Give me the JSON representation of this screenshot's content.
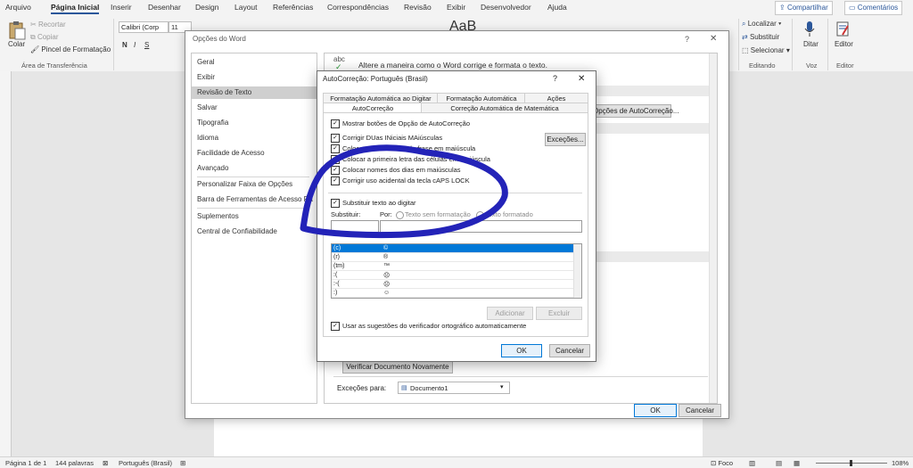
{
  "ribbon_tabs": [
    "Arquivo",
    "Página Inicial",
    "Inserir",
    "Desenhar",
    "Design",
    "Layout",
    "Referências",
    "Correspondências",
    "Revisão",
    "Exibir",
    "Desenvolvedor",
    "Ajuda"
  ],
  "top_buttons": {
    "share": "Compartilhar",
    "comments": "Comentários"
  },
  "clipboard": {
    "paste": "Colar",
    "cut": "Recortar",
    "copy": "Copiar",
    "format_painter": "Pincel de Formatação",
    "group": "Área de Transferência"
  },
  "font": {
    "name": "Calibri (Corp",
    "size": "11",
    "bold": "N",
    "italic": "I",
    "underline": "S"
  },
  "editing": {
    "find": "Localizar",
    "replace": "Substituir",
    "select": "Selecionar",
    "group": "Editando"
  },
  "voice": {
    "dictate": "Ditar",
    "group": "Voz"
  },
  "editor": {
    "label": "Editor",
    "group": "Editor"
  },
  "styles_preview": "AaB",
  "word_options": {
    "title": "Opções do Word",
    "nav": [
      "Geral",
      "Exibir",
      "Revisão de Texto",
      "Salvar",
      "Tipografia",
      "Idioma",
      "Facilidade de Acesso",
      "Avançado",
      "Personalizar Faixa de Opções",
      "Barra de Ferramentas de Acesso Rápido",
      "Suplementos",
      "Central de Confiabilidade"
    ],
    "header_icon": "abc",
    "header_text": "Altere a maneira como o Word corrige e formata o texto.",
    "autocorrect_options_button": "Opções de AutoCorreção...",
    "recheck_button": "Verificar Documento Novamente",
    "exceptions_label": "Exceções para:",
    "exceptions_value": "Documento1",
    "ok": "OK",
    "cancel": "Cancelar"
  },
  "autocorrect": {
    "title": "AutoCorreção: Português (Brasil)",
    "tabs_row1": [
      "Formatação Automática ao Digitar",
      "Formatação Automática",
      "Ações"
    ],
    "tabs_row2": [
      "AutoCorreção",
      "Correção Automática de Matemática"
    ],
    "show_buttons": "Mostrar botões de Opção de AutoCorreção",
    "two_initial": "Corrigir DUas INiciais MAiúsculas",
    "first_letter_sentence": "Colocar primeira letra da frase em maiúscula",
    "first_letter_cells": "Colocar a primeira letra das células em maiúscula",
    "day_names": "Colocar nomes dos dias em maiúsculas",
    "caps_lock": "Corrigir uso acidental da tecla cAPS LOCK",
    "exceptions_button": "Exceções...",
    "replace_as_type": "Substituir texto ao digitar",
    "replace_label": "Substituir:",
    "with_label": "Por:",
    "plain_text": "Texto sem formatação",
    "formatted_text": "Texto formatado",
    "list": [
      {
        "from": "(c)",
        "to": "©"
      },
      {
        "from": "(r)",
        "to": "®"
      },
      {
        "from": "(tm)",
        "to": "™"
      },
      {
        "from": ":(",
        "to": "☹"
      },
      {
        "from": ":-(",
        "to": "☹"
      },
      {
        "from": ":)",
        "to": "☺"
      }
    ],
    "add_button": "Adicionar",
    "delete_button": "Excluir",
    "spellcheck": "Usar as sugestões do verificador ortográfico automaticamente",
    "ok": "OK",
    "cancel": "Cancelar"
  },
  "status": {
    "page": "Página 1 de 1",
    "words": "144 palavras",
    "language": "Português (Brasil)",
    "focus": "Foco",
    "zoom": "108%"
  },
  "colors": {
    "accent": "#2b579a",
    "selection": "#0078d7",
    "ink": "#2323b8"
  }
}
